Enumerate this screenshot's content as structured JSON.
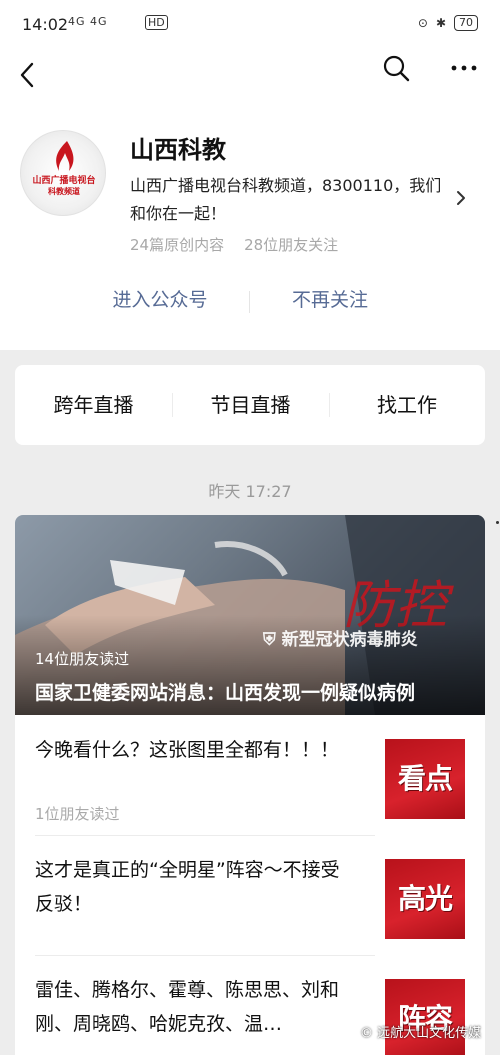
{
  "status_bar": {
    "time": "14:02",
    "signals": "4G 4G",
    "hd": "HD",
    "battery": "70"
  },
  "nav": {
    "back_icon": "chevron-left-icon",
    "search_icon": "search-icon",
    "more_icon": "more-icon"
  },
  "account": {
    "logo_line1": "山西广播电视台",
    "logo_line2": "科教频道",
    "name": "山西科教",
    "description": "山西广播电视台科教频道，8300110，我们和你在一起！",
    "original_count": "24篇原创内容",
    "friends_following": "28位朋友关注",
    "enter_label": "进入公众号",
    "unfollow_label": "不再关注"
  },
  "menu": {
    "items": [
      "跨年直播",
      "节目直播",
      "找工作"
    ]
  },
  "timeline": {
    "time": "昨天 17:27"
  },
  "feature": {
    "badge": "新型冠状病毒肺炎",
    "seal": "防控",
    "read_count": "14位朋友读过",
    "title": "国家卫健委网站消息：山西发现一例疑似病例"
  },
  "articles": [
    {
      "title": "今晚看什么？这张图里全都有！！！",
      "meta": "1位朋友读过",
      "thumb": "看点"
    },
    {
      "title": "这才是真正的“全明星”阵容～不接受反驳！",
      "meta": "",
      "thumb": "高光"
    },
    {
      "title": "雷佳、腾格尔、霍尊、陈思思、刘和刚、周晓鸥、哈妮克孜、温…",
      "meta": "",
      "thumb": "阵容"
    }
  ],
  "watermark": "© 远航大山文化传媒",
  "colors": {
    "link": "#576b95",
    "brand_red": "#c8161e"
  }
}
